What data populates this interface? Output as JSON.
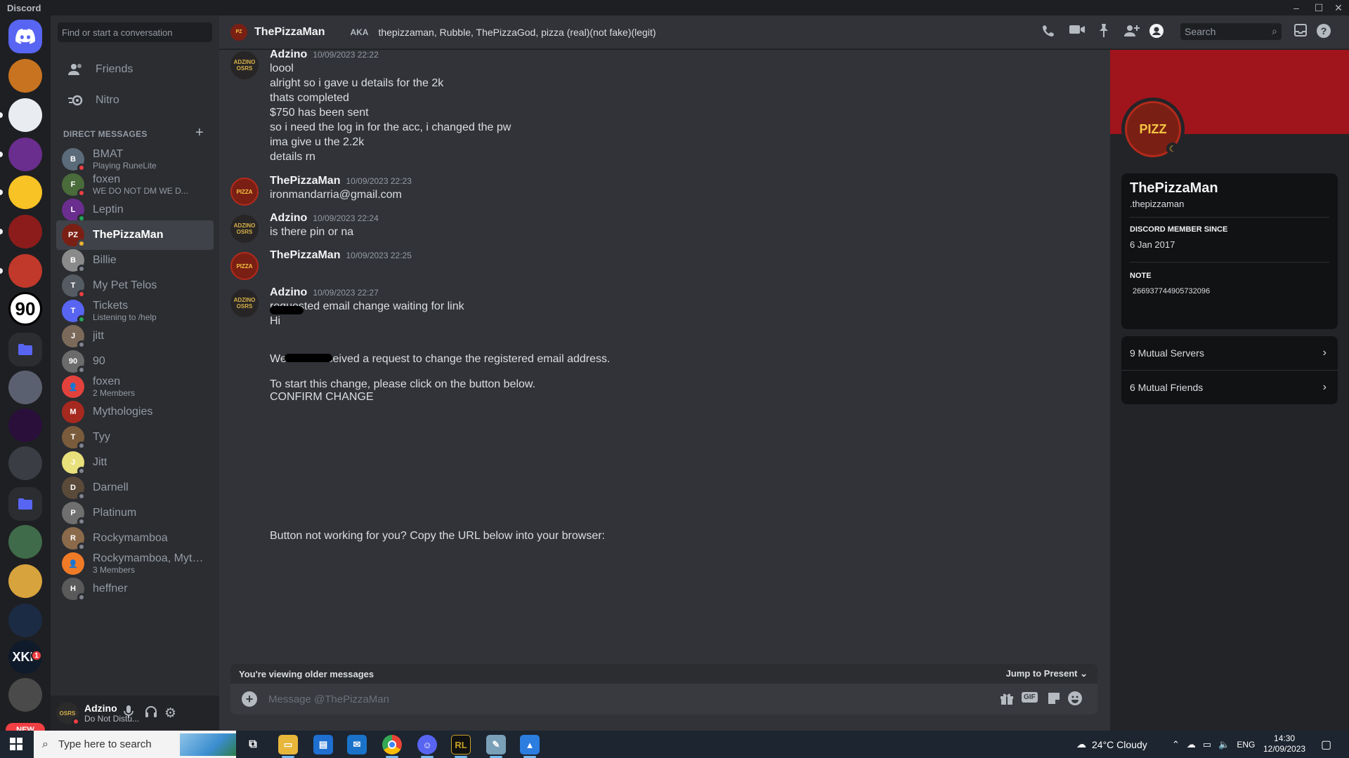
{
  "window": {
    "title": "Discord",
    "controls": {
      "minimize": "–",
      "maximize": "☐",
      "close": "✕"
    }
  },
  "servers": [
    {
      "label": "",
      "icon": "burger",
      "color": "#c8731f"
    },
    {
      "label": "",
      "icon": "hockey-logo",
      "color": "#e9edf2"
    },
    {
      "label": "",
      "icon": "purple-avatar",
      "color": "#6a2e8e"
    },
    {
      "label": "",
      "icon": "shush-emoji",
      "color": "#f7c325"
    },
    {
      "label": "",
      "icon": "spartan-logo",
      "color": "#8c1c1c"
    },
    {
      "label": "",
      "icon": "santa-hat",
      "color": "#c0392b"
    },
    {
      "label": "90",
      "icon": "",
      "color": "#ffffff"
    },
    {
      "label": "",
      "icon": "folder",
      "color": "#2b2d31"
    },
    {
      "label": "",
      "icon": "statue",
      "color": "#5b6070"
    },
    {
      "label": "",
      "icon": "purple-creature",
      "color": "#2a0f3a"
    },
    {
      "label": "",
      "icon": "helmet",
      "color": "#3a3d43"
    },
    {
      "label": "",
      "icon": "folder",
      "color": "#2b2d31"
    },
    {
      "label": "",
      "icon": "king-avatar",
      "color": "#3f6b4a"
    },
    {
      "label": "",
      "icon": "duck",
      "color": "#d7a33d"
    },
    {
      "label": "",
      "icon": "crest",
      "color": "#1c2b44"
    },
    {
      "label": "XKP",
      "icon": "",
      "color": "#0f1a2a"
    },
    {
      "label": "",
      "icon": "person",
      "color": "#4a4a4a"
    }
  ],
  "server_badges": {
    "unread_count": "1",
    "new_label": "NEW"
  },
  "sidebar": {
    "search_placeholder": "Find or start a conversation",
    "friends": "Friends",
    "nitro": "Nitro",
    "dm_header": "DIRECT MESSAGES",
    "dms": [
      {
        "name": "BMAT",
        "sub": "Playing RuneLite",
        "status": "dnd",
        "color": "#5b6b7a",
        "initials": "B"
      },
      {
        "name": "foxen",
        "sub": "WE DO NOT DM WE D...",
        "status": "dnd",
        "color": "#4a6b3a",
        "initials": "F"
      },
      {
        "name": "Leptin",
        "sub": "",
        "status": "online",
        "color": "#6a2e8e",
        "initials": "L"
      },
      {
        "name": "ThePizzaMan",
        "sub": "",
        "status": "idle",
        "color": "#7a1f14",
        "initials": "PZ"
      },
      {
        "name": "Billie",
        "sub": "",
        "status": "offline",
        "color": "#8a8a8a",
        "initials": "B"
      },
      {
        "name": "My Pet Telos",
        "sub": "",
        "status": "dnd",
        "color": "#555b63",
        "initials": "T"
      },
      {
        "name": "Tickets",
        "sub": "Listening to /help",
        "status": "online",
        "color": "#5865f2",
        "initials": "T"
      },
      {
        "name": "jitt",
        "sub": "",
        "status": "offline",
        "color": "#7b6a5a",
        "initials": "J"
      },
      {
        "name": "90",
        "sub": "",
        "status": "offline",
        "color": "#6b6b6b",
        "initials": "90"
      },
      {
        "name": "foxen",
        "sub": "2 Members",
        "status": "",
        "color": "#e3423c",
        "initials": "👤"
      },
      {
        "name": "Mythologies",
        "sub": "",
        "status": "",
        "color": "#a6291f",
        "initials": "M"
      },
      {
        "name": "Tyy",
        "sub": "",
        "status": "offline",
        "color": "#7a5c3c",
        "initials": "T"
      },
      {
        "name": "Jitt",
        "sub": "",
        "status": "offline",
        "color": "#e8e07a",
        "initials": "J"
      },
      {
        "name": "Darnell",
        "sub": "",
        "status": "offline",
        "color": "#5a4a3a",
        "initials": "D"
      },
      {
        "name": "Platinum",
        "sub": "",
        "status": "offline",
        "color": "#6f6f6f",
        "initials": "P"
      },
      {
        "name": "Rockymamboa",
        "sub": "",
        "status": "offline",
        "color": "#8a6a4a",
        "initials": "R"
      },
      {
        "name": "Rockymamboa, Myth...",
        "sub": "3 Members",
        "status": "",
        "color": "#f07b27",
        "initials": "👤"
      },
      {
        "name": "heffner",
        "sub": "",
        "status": "offline",
        "color": "#5a5a5a",
        "initials": "H"
      }
    ]
  },
  "user": {
    "name": "Adzino",
    "status": "Do Not Distu...",
    "avatar_text": "OSRS"
  },
  "header": {
    "title": "ThePizzaMan",
    "aka_label": "AKA",
    "aka_names": "thepizzaman, Rubble, ThePizzaGod, pizza (real)(not fake)(legit)",
    "search_placeholder": "Search"
  },
  "messages": [
    {
      "author": "Adzino",
      "time": "10/09/2023 22:22",
      "avatar": "ADZINO OSRS",
      "lines": [
        "loool",
        "alright so i gave u details for the 2k",
        "thats completed",
        "$750 has been sent",
        "so i need the log in for the acc, i changed the pw",
        "ima give u the 2.2k",
        "details rn"
      ]
    },
    {
      "author": "ThePizzaMan",
      "time": "10/09/2023 22:23",
      "avatar": "PIZZA",
      "lines": [
        "ironmandarria@gmail.com"
      ]
    },
    {
      "author": "Adzino",
      "time": "10/09/2023 22:24",
      "avatar": "ADZINO OSRS",
      "lines": [
        "is there pin or na"
      ]
    },
    {
      "author": "ThePizzaMan",
      "time": "10/09/2023 22:25",
      "avatar": "PIZZA",
      "lines": []
    },
    {
      "author": "Adzino",
      "time": "10/09/2023 22:27",
      "avatar": "ADZINO OSRS",
      "lines": [
        "requested email change waiting for link",
        "Hi",
        "We have received a request to change the registered email address.",
        "To start this change, please click on the button below.",
        "CONFIRM CHANGE",
        "Button not working for you? Copy the URL below into your browser:"
      ]
    }
  ],
  "older_bar": {
    "text": "You're viewing older messages",
    "jump": "Jump to Present"
  },
  "composer": {
    "placeholder": "Message @ThePizzaMan",
    "gif": "GIF"
  },
  "profile": {
    "name": "ThePizzaMan",
    "username": ".thepizzaman",
    "avatar_text": "PIZZ",
    "member_since_label": "DISCORD MEMBER SINCE",
    "member_since": "6 Jan 2017",
    "note_label": "NOTE",
    "note": "266937744905732096",
    "mutual_servers": "9 Mutual Servers",
    "mutual_friends": "6 Mutual Friends"
  },
  "taskbar": {
    "search_placeholder": "Type here to search",
    "weather": "24°C  Cloudy",
    "lang": "ENG",
    "time": "14:30",
    "date": "12/09/2023"
  }
}
